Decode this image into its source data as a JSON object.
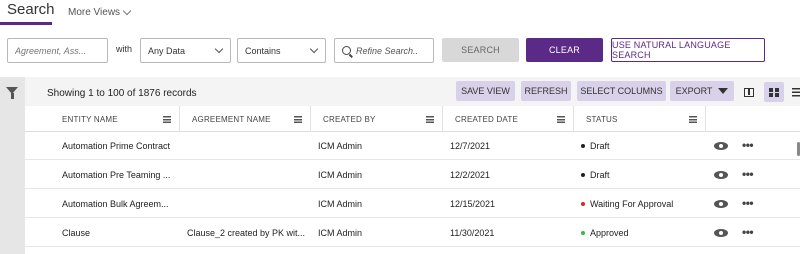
{
  "header": {
    "title": "Search",
    "more_views_label": "More Views"
  },
  "search_bar": {
    "keyword_placeholder": "Agreement, Ass...",
    "with_label": "with",
    "field_selected": "Any Data",
    "operator_selected": "Contains",
    "refine_placeholder": "Refine Search..",
    "search_label": "SEARCH",
    "clear_label": "CLEAR",
    "nls_label": "USE NATURAL LANGUAGE SEARCH"
  },
  "toolbar": {
    "showing_text": "Showing 1 to 100 of 1876 records",
    "save_view_label": "SAVE VIEW",
    "refresh_label": "REFRESH",
    "select_columns_label": "SELECT COLUMNS",
    "export_label": "EXPORT"
  },
  "columns": [
    "ENTITY NAME",
    "AGREEMENT NAME",
    "CREATED BY",
    "CREATED DATE",
    "STATUS"
  ],
  "rows": [
    {
      "entity_name": "Automation Prime Contract",
      "agreement_name": "",
      "created_by": "ICM Admin",
      "created_date": "12/7/2021",
      "status": "Draft",
      "status_color": "#222222"
    },
    {
      "entity_name": "Automation Pre Teaming ...",
      "agreement_name": "",
      "created_by": "ICM Admin",
      "created_date": "12/2/2021",
      "status": "Draft",
      "status_color": "#222222"
    },
    {
      "entity_name": "Automation Bulk Agreem...",
      "agreement_name": "",
      "created_by": "ICM Admin",
      "created_date": "12/15/2021",
      "status": "Waiting For Approval",
      "status_color": "#e02424"
    },
    {
      "entity_name": "Clause",
      "agreement_name": "Clause_2 created by PK wit...",
      "created_by": "ICM Admin",
      "created_date": "11/30/2021",
      "status": "Approved",
      "status_color": "#2fbf3a"
    }
  ],
  "colors": {
    "brand": "#5b2a86",
    "toolbar_button_bg": "#d9d0ea"
  }
}
